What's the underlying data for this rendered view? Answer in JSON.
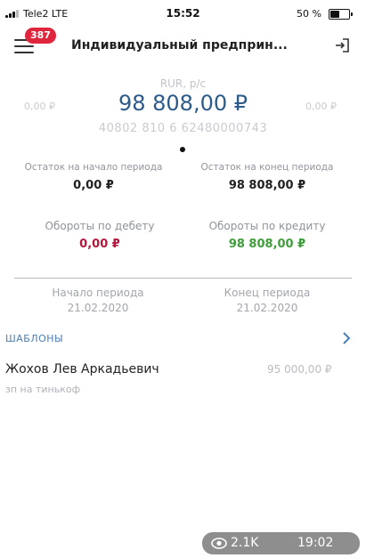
{
  "status_bar": {
    "carrier": "Tele2  LTE",
    "time": "15:52",
    "battery": "50 %",
    "battery_level": 0.5
  },
  "header": {
    "badge": "387",
    "title": "Индивидуальный предприн..."
  },
  "account": {
    "type": "RUR, р/с",
    "amount": "98 808,00 ₽",
    "left_amount": "0,00 ₽",
    "right_amount": "0,00 ₽",
    "number": "40802 810 6 62480000743"
  },
  "balances": {
    "start_label": "Остаток на начало периода",
    "start_value": "0,00 ₽",
    "end_label": "Остаток на конец периода",
    "end_value": "98 808,00 ₽",
    "debit_label": "Обороты по дебету",
    "debit_value": "0,00 ₽",
    "credit_label": "Обороты по кредиту",
    "credit_value": "98 808,00 ₽"
  },
  "period": {
    "start_label": "Начало периода",
    "start_date": "21.02.2020",
    "end_label": "Конец периода",
    "end_date": "21.02.2020"
  },
  "templates": {
    "heading": "ШАБЛОНЫ",
    "items": [
      {
        "name": "Жохов Лев Аркадьевич",
        "amount": "95 000,00 ₽",
        "description": "зп на тинькоф"
      }
    ]
  },
  "overlay": {
    "views": "2.1K",
    "time": "19:02"
  },
  "colors": {
    "accent": "#2c5a8a",
    "badge": "#e0263c",
    "debit": "#b3183d",
    "credit": "#3f9e3a",
    "link": "#4a7db5"
  }
}
